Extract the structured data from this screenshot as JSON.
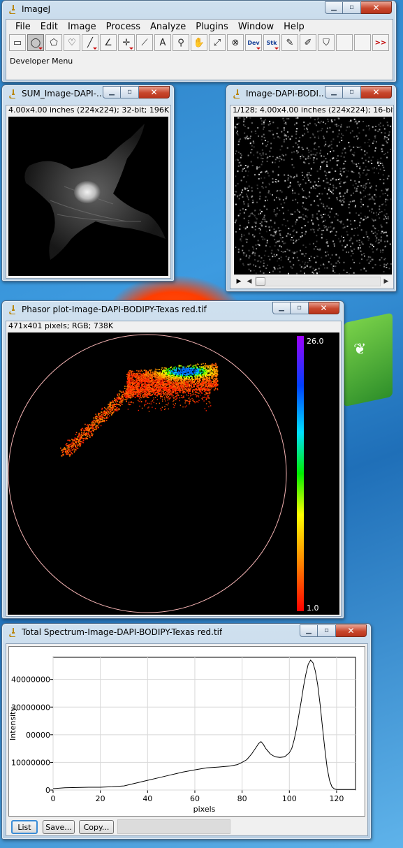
{
  "imagej": {
    "title": "ImageJ",
    "menu": [
      "File",
      "Edit",
      "Image",
      "Process",
      "Analyze",
      "Plugins",
      "Window",
      "Help"
    ],
    "tools": [
      {
        "name": "rectangle-tool-icon",
        "glyph": "▭",
        "selected": false,
        "dropdown": false
      },
      {
        "name": "oval-tool-icon",
        "glyph": "◯",
        "selected": true,
        "dropdown": true
      },
      {
        "name": "polygon-tool-icon",
        "glyph": "⬠",
        "selected": false,
        "dropdown": false
      },
      {
        "name": "freehand-tool-icon",
        "glyph": "♡",
        "selected": false,
        "dropdown": false
      },
      {
        "name": "line-tool-icon",
        "glyph": "╱",
        "selected": false,
        "dropdown": true
      },
      {
        "name": "angle-tool-icon",
        "glyph": "∠",
        "selected": false,
        "dropdown": false
      },
      {
        "name": "point-tool-icon",
        "glyph": "✛",
        "selected": false,
        "dropdown": true
      },
      {
        "name": "wand-tool-icon",
        "glyph": "⟋",
        "selected": false,
        "dropdown": false
      },
      {
        "name": "text-tool-icon",
        "glyph": "A",
        "selected": false,
        "dropdown": false
      },
      {
        "name": "magnifier-tool-icon",
        "glyph": "⚲",
        "selected": false,
        "dropdown": false
      },
      {
        "name": "hand-tool-icon",
        "glyph": "✋",
        "selected": false,
        "dropdown": false
      },
      {
        "name": "dropper-tool-icon",
        "glyph": "⤢",
        "selected": false,
        "dropdown": false
      },
      {
        "name": "stop-tool-icon",
        "glyph": "⊗",
        "selected": false,
        "dropdown": false
      },
      {
        "name": "dev-menu-tool-icon",
        "glyph": "Dev",
        "selected": false,
        "dropdown": true,
        "text": true
      },
      {
        "name": "stk-menu-tool-icon",
        "glyph": "Stk",
        "selected": false,
        "dropdown": true,
        "text": true
      },
      {
        "name": "pencil-tool-icon",
        "glyph": "✎",
        "selected": false,
        "dropdown": false
      },
      {
        "name": "brush-tool-icon",
        "glyph": "✐",
        "selected": false,
        "dropdown": false
      },
      {
        "name": "flood-fill-tool-icon",
        "glyph": "⛉",
        "selected": false,
        "dropdown": false
      },
      {
        "name": "empty-tool-slot-icon",
        "glyph": "",
        "selected": false,
        "dropdown": false
      },
      {
        "name": "empty-tool-slot-icon",
        "glyph": "",
        "selected": false,
        "dropdown": false
      },
      {
        "name": "more-tools-icon",
        "glyph": ">>",
        "selected": false,
        "dropdown": false,
        "more": true
      }
    ],
    "status": "Developer Menu"
  },
  "sum_window": {
    "title": "SUM_Image-DAPI-...",
    "info": "4.00x4.00 inches (224x224); 32-bit; 196K"
  },
  "stack_window": {
    "title": "Image-DAPI-BODI...",
    "info": "1/128; 4.00x4.00 inches (224x224); 16-bit;"
  },
  "phasor_window": {
    "title": "Phasor plot-Image-DAPI-BODIPY-Texas red.tif",
    "info": "471x401 pixels; RGB; 738K",
    "colorbar_max": "26.0",
    "colorbar_min": "1.0"
  },
  "spectrum_window": {
    "title": "Total Spectrum-Image-DAPI-BODIPY-Texas red.tif",
    "buttons": {
      "list": "List",
      "save": "Save...",
      "copy": "Copy..."
    }
  },
  "chart_data": {
    "type": "line",
    "xlabel": "pixels",
    "ylabel": "Intensity",
    "xlim": [
      0,
      128
    ],
    "ylim": [
      0,
      48000000
    ],
    "xticks": [
      0,
      20,
      40,
      60,
      80,
      100,
      120
    ],
    "xtick_labels": [
      "0",
      "20",
      "40",
      "60",
      "80",
      "100",
      "120"
    ],
    "yticks": [
      0,
      10000000,
      20000000,
      30000000,
      40000000
    ],
    "ytick_labels": [
      "0",
      "10000000",
      "00000",
      "30000000",
      "40000000"
    ],
    "grid": true,
    "series": [
      {
        "x": [
          0,
          5,
          10,
          15,
          20,
          25,
          30,
          35,
          40,
          45,
          50,
          55,
          60,
          65,
          70,
          75,
          78,
          80,
          82,
          84,
          86,
          87,
          88,
          89,
          90,
          92,
          94,
          96,
          98,
          100,
          101,
          102,
          103,
          104,
          105,
          106,
          107,
          108,
          109,
          110,
          111,
          112,
          113,
          114,
          115,
          116,
          117,
          118,
          119,
          120,
          122,
          124,
          126,
          128
        ],
        "y": [
          500000,
          800000,
          900000,
          1000000,
          1000000,
          1200000,
          1500000,
          2500000,
          3500000,
          4500000,
          5500000,
          6500000,
          7300000,
          8000000,
          8300000,
          8700000,
          9200000,
          10000000,
          11000000,
          13000000,
          15500000,
          16800000,
          17500000,
          16500000,
          15000000,
          13000000,
          12000000,
          11800000,
          12000000,
          13500000,
          15000000,
          18000000,
          22000000,
          27000000,
          32000000,
          37500000,
          42000000,
          45500000,
          47000000,
          46000000,
          43000000,
          38000000,
          31000000,
          23000000,
          15000000,
          8000000,
          3500000,
          1200000,
          400000,
          200000,
          200000,
          200000,
          200000,
          200000
        ]
      }
    ]
  }
}
